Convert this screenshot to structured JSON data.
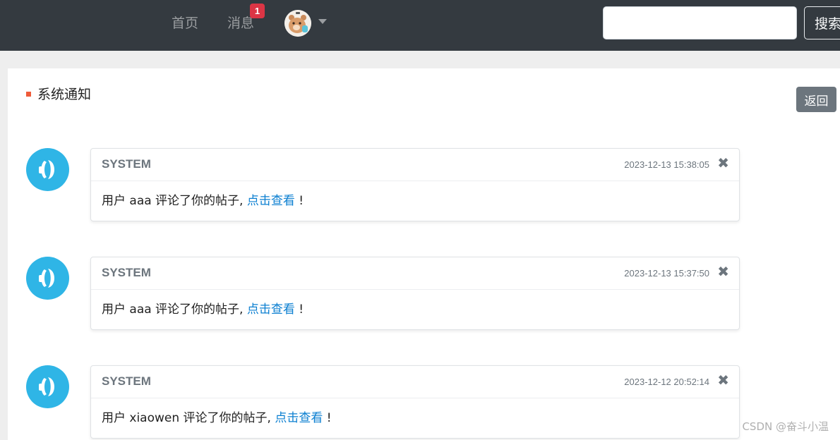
{
  "nav": {
    "home_label": "首页",
    "messages_label": "消息",
    "messages_badge": "1",
    "avatar_icon": "user-avatar-bear",
    "dropdown_icon": "caret-down-icon",
    "search_placeholder": "",
    "search_button_label": "搜索"
  },
  "section": {
    "title": "系统通知",
    "back_label": "返回",
    "marker_color": "#ef5b3a"
  },
  "notices": [
    {
      "sender": "SYSTEM",
      "time": "2023-12-13 15:38:05",
      "text_prefix": "用户 aaa 评论了你的帖子, ",
      "link_label": "点击查看",
      "text_suffix": " !"
    },
    {
      "sender": "SYSTEM",
      "time": "2023-12-13 15:37:50",
      "text_prefix": "用户 aaa 评论了你的帖子, ",
      "link_label": "点击查看",
      "text_suffix": " !"
    },
    {
      "sender": "SYSTEM",
      "time": "2023-12-12 20:52:14",
      "text_prefix": "用户 xiaowen 评论了你的帖子, ",
      "link_label": "点击查看",
      "text_suffix": " !"
    }
  ],
  "close_glyph": "✖",
  "watermark": "CSDN @奋斗小温",
  "colors": {
    "navbar": "#343a40",
    "badge": "#dc3545",
    "link": "#0b7fd1",
    "system_avatar": "#2fb5e6",
    "back_button": "#6c757d"
  }
}
